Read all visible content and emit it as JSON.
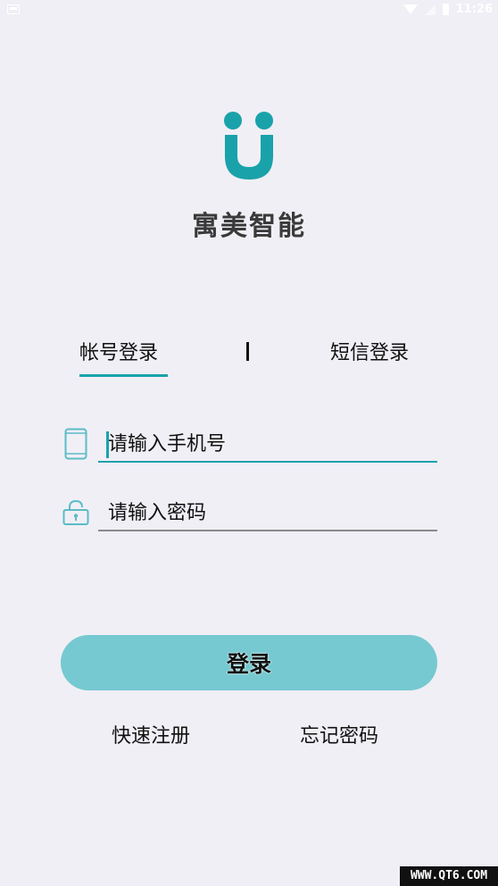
{
  "status_bar": {
    "time": "11:26",
    "icons": [
      "screenshot-icon",
      "wifi-icon",
      "signal-icon",
      "battery-icon"
    ]
  },
  "brand": {
    "name": "寓美智能",
    "logo_color": "#1aa2aa"
  },
  "tabs": [
    {
      "label": "帐号登录",
      "active": true
    },
    {
      "label": "短信登录",
      "active": false
    }
  ],
  "form": {
    "phone_placeholder": "请输入手机号",
    "password_placeholder": "请输入密码"
  },
  "login_button": {
    "label": "登录",
    "color": "#76c9d1"
  },
  "links": {
    "register": "快速注册",
    "forgot_password": "忘记密码"
  },
  "watermark": "WWW.QT6.COM",
  "colors": {
    "accent": "#1aa2aa",
    "background": "#f0eff5"
  }
}
